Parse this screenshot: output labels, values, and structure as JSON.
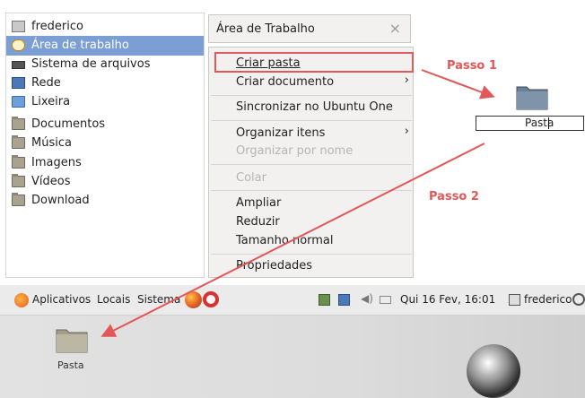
{
  "sidebar": {
    "items": [
      {
        "label": "frederico",
        "icon": "home-folder-icon"
      },
      {
        "label": "Área de trabalho",
        "icon": "desktop-icon",
        "selected": true
      },
      {
        "label": "Sistema de arquivos",
        "icon": "drive-icon"
      },
      {
        "label": "Rede",
        "icon": "network-icon"
      },
      {
        "label": "Lixeira",
        "icon": "trash-icon"
      },
      {
        "label": "Documentos",
        "icon": "folder-icon"
      },
      {
        "label": "Música",
        "icon": "folder-icon"
      },
      {
        "label": "Imagens",
        "icon": "folder-icon"
      },
      {
        "label": "Vídeos",
        "icon": "folder-icon"
      },
      {
        "label": "Download",
        "icon": "folder-icon"
      }
    ]
  },
  "context_tab": {
    "title": "Área de Trabalho",
    "close_glyph": "×"
  },
  "context_menu": {
    "criar_pasta": "Criar pasta",
    "criar_documento": "Criar documento",
    "sincronizar": "Sincronizar no Ubuntu One",
    "organizar_itens": "Organizar itens",
    "organizar_nome": "Organizar por nome",
    "colar": "Colar",
    "ampliar": "Ampliar",
    "reduzir": "Reduzir",
    "tamanho_normal": "Tamanho normal",
    "propriedades": "Propriedades",
    "arrow": "›"
  },
  "steps": {
    "step1": "Passo 1",
    "step2": "Passo 2"
  },
  "new_folder": {
    "rename_value": "Pasta"
  },
  "panel": {
    "aplicativos": "Aplicativos",
    "locais": "Locais",
    "sistema": "Sistema",
    "datetime": "Qui 16 Fev, 16:01",
    "user": "frederico"
  },
  "desktop": {
    "folder_label": "Pasta"
  },
  "colors": {
    "accent": "#7b9fd4",
    "highlight": "#e05a5a",
    "step_text": "#e25757"
  }
}
